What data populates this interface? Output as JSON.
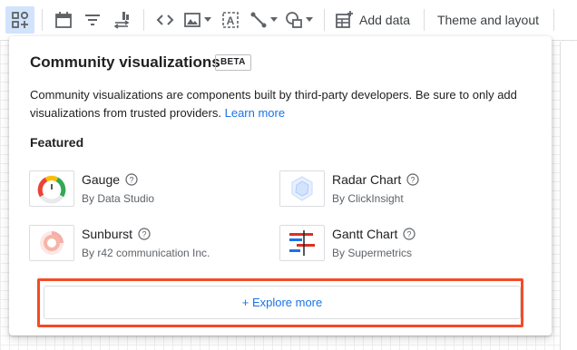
{
  "toolbar": {
    "add_data_label": "Add data",
    "theme_layout_label": "Theme and layout",
    "icons": [
      "add-chart-icon",
      "calendar-icon",
      "filter-icon",
      "data-control-icon",
      "code-icon",
      "image-icon",
      "text-icon",
      "line-icon",
      "shape-icon",
      "add-data-icon"
    ]
  },
  "panel": {
    "title": "Community visualizations",
    "badge": "BETA",
    "description": "Community visualizations are components built by third-party developers. Be sure to only add visualizations from trusted providers.",
    "learn_more": "Learn more",
    "featured_heading": "Featured",
    "items": [
      {
        "name": "Gauge",
        "by": "By Data Studio",
        "icon": "gauge-thumbnail"
      },
      {
        "name": "Radar Chart",
        "by": "By ClickInsight",
        "icon": "radar-chart-thumbnail"
      },
      {
        "name": "Sunburst",
        "by": "By r42 communication Inc.",
        "icon": "sunburst-thumbnail"
      },
      {
        "name": "Gantt Chart",
        "by": "By Supermetrics",
        "icon": "gantt-chart-thumbnail"
      }
    ],
    "explore_button": "+ Explore more"
  },
  "colors": {
    "accent": "#1a73e8",
    "highlight_outline": "#f44b26",
    "active_toolbar_bg": "#d2e3fc"
  }
}
